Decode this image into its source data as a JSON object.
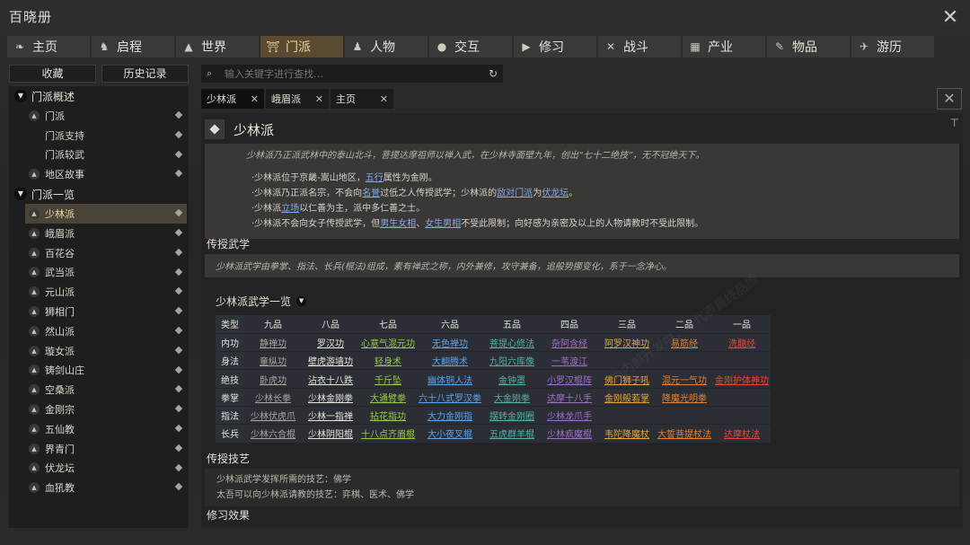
{
  "app": {
    "title": "百晓册",
    "close_icon": "close-x-icon"
  },
  "nav": {
    "tabs": [
      {
        "label": "主页",
        "icon": "book-icon"
      },
      {
        "label": "启程",
        "icon": "horse-icon"
      },
      {
        "label": "世界",
        "icon": "mountain-icon"
      },
      {
        "label": "门派",
        "icon": "gate-icon",
        "active": true
      },
      {
        "label": "人物",
        "icon": "person-icon"
      },
      {
        "label": "交互",
        "icon": "chat-icon"
      },
      {
        "label": "修习",
        "icon": "scroll-icon"
      },
      {
        "label": "战斗",
        "icon": "swords-icon"
      },
      {
        "label": "产业",
        "icon": "building-icon"
      },
      {
        "label": "物品",
        "icon": "item-icon"
      },
      {
        "label": "游历",
        "icon": "travel-icon"
      }
    ]
  },
  "left": {
    "favorites": "收藏",
    "history": "历史记录",
    "groups": [
      {
        "label": "门派概述",
        "items": [
          {
            "label": "门派",
            "expandable": true
          },
          {
            "label": "门派支持",
            "expandable": false
          },
          {
            "label": "门派较武",
            "expandable": false
          },
          {
            "label": "地区故事",
            "expandable": true
          }
        ]
      },
      {
        "label": "门派一览",
        "items": [
          {
            "label": "少林派",
            "expandable": true,
            "active": true
          },
          {
            "label": "峨眉派",
            "expandable": true
          },
          {
            "label": "百花谷",
            "expandable": true
          },
          {
            "label": "武当派",
            "expandable": true
          },
          {
            "label": "元山派",
            "expandable": true
          },
          {
            "label": "狮相门",
            "expandable": true
          },
          {
            "label": "然山派",
            "expandable": true
          },
          {
            "label": "璇女派",
            "expandable": true
          },
          {
            "label": "铸剑山庄",
            "expandable": true
          },
          {
            "label": "空桑派",
            "expandable": true
          },
          {
            "label": "金刚宗",
            "expandable": true
          },
          {
            "label": "五仙教",
            "expandable": true
          },
          {
            "label": "界青门",
            "expandable": true
          },
          {
            "label": "伏龙坛",
            "expandable": true
          },
          {
            "label": "血犼教",
            "expandable": true
          }
        ]
      }
    ]
  },
  "search": {
    "placeholder": "输入关键字进行查找…",
    "value": ""
  },
  "page_tabs": [
    {
      "label": "少林派",
      "active": true
    },
    {
      "label": "峨眉派"
    },
    {
      "label": "主页"
    }
  ],
  "page": {
    "title": "少林派",
    "quote": "少林派乃正派武林中的泰山北斗，菩提达摩祖师以禅入武，在少林寺面壁九年，创出“七十二绝技”，无不冠绝天下。",
    "bullets": [
      [
        {
          "t": "·少林派位于京畿-嵩山地区，"
        },
        {
          "t": "五行",
          "link": true
        },
        {
          "t": "属性为金刚。"
        }
      ],
      [
        {
          "t": "·少林派乃正派名宗，不会向"
        },
        {
          "t": "名誉",
          "link": true
        },
        {
          "t": "过低之人传授武学；少林派的"
        },
        {
          "t": "敌对门派",
          "link": true
        },
        {
          "t": "为"
        },
        {
          "t": "伏龙坛",
          "link": true
        },
        {
          "t": "。"
        }
      ],
      [
        {
          "t": "·少林派"
        },
        {
          "t": "立场",
          "link": true
        },
        {
          "t": "以仁善为主，派中多仁善之士。"
        }
      ],
      [
        {
          "t": "·少林派不会向女子传授武学，但"
        },
        {
          "t": "男生女相",
          "link": true
        },
        {
          "t": "、"
        },
        {
          "t": "女生男相",
          "link": true
        },
        {
          "t": "不受此限制；向好感为亲密及以上的人物请教时不受此限制。"
        }
      ]
    ],
    "sec_wuxue": "传授武学",
    "wuxue_desc": "少林派武学由拳掌、指法、长兵(棍法)组成，素有禅武之称，内外兼修，攻守兼备，追般势挪变化，系于一念净心。",
    "martial_title": "少林派武学一览",
    "table": {
      "header": [
        "类型",
        "九品",
        "八品",
        "七品",
        "六品",
        "五品",
        "四品",
        "三品",
        "二品",
        "一品"
      ],
      "rows": [
        {
          "type": "内功",
          "cells": [
            {
              "t": "静禅功",
              "c": "#a9a59d"
            },
            {
              "t": "罗汉功",
              "c": "#e8e3d9"
            },
            {
              "t": "心意气混元功",
              "c": "#9ac94a"
            },
            {
              "t": "无色禅功",
              "c": "#5ea2e8"
            },
            {
              "t": "菩提心修法",
              "c": "#56b0a8"
            },
            {
              "t": "杂阿含经",
              "c": "#a070c8"
            },
            {
              "t": "阿罗汉神功",
              "c": "#e3a53a"
            },
            {
              "t": "易筋经",
              "c": "#e08030"
            },
            {
              "t": "洗髓经",
              "c": "#e04a3a"
            }
          ]
        },
        {
          "type": "身法",
          "cells": [
            {
              "t": "童纵功",
              "c": "#a9a59d"
            },
            {
              "t": "壁虎游墙功",
              "c": "#e8e3d9"
            },
            {
              "t": "轻身术",
              "c": "#9ac94a"
            },
            {
              "t": "大翻腾术",
              "c": "#5ea2e8"
            },
            {
              "t": "九阳六库像",
              "c": "#56b0a8"
            },
            {
              "t": "一苇渡江",
              "c": "#a070c8"
            },
            {
              "t": "",
              "c": "#888"
            },
            {
              "t": "",
              "c": "#888"
            },
            {
              "t": "",
              "c": "#888"
            }
          ]
        },
        {
          "type": "绝技",
          "cells": [
            {
              "t": "卧虎功",
              "c": "#a9a59d"
            },
            {
              "t": "沾衣十八跌",
              "c": "#e8e3d9"
            },
            {
              "t": "千斤坠",
              "c": "#9ac94a"
            },
            {
              "t": "幽体铜人法",
              "c": "#5ea2e8"
            },
            {
              "t": "金钟罩",
              "c": "#56b0a8"
            },
            {
              "t": "小罗汉棍阵",
              "c": "#a070c8"
            },
            {
              "t": "佛门狮子吼",
              "c": "#e3a53a"
            },
            {
              "t": "混元一气功",
              "c": "#e08030"
            },
            {
              "t": "金刚护体神功",
              "c": "#e04a3a"
            }
          ]
        },
        {
          "type": "拳掌",
          "cells": [
            {
              "t": "少林长拳",
              "c": "#a9a59d"
            },
            {
              "t": "少林金刚拳",
              "c": "#e8e3d9"
            },
            {
              "t": "大通臂拳",
              "c": "#9ac94a"
            },
            {
              "t": "六十八式罗汉拳",
              "c": "#5ea2e8"
            },
            {
              "t": "大金刚拳",
              "c": "#56b0a8"
            },
            {
              "t": "达摩十八手",
              "c": "#a070c8"
            },
            {
              "t": "金刚般若掌",
              "c": "#e3a53a"
            },
            {
              "t": "降魔光明拳",
              "c": "#e08030"
            },
            {
              "t": "",
              "c": "#888"
            }
          ]
        },
        {
          "type": "指法",
          "cells": [
            {
              "t": "少林伏虎爪",
              "c": "#a9a59d"
            },
            {
              "t": "少林一指禅",
              "c": "#e8e3d9"
            },
            {
              "t": "拈花指功",
              "c": "#9ac94a"
            },
            {
              "t": "大力金刚指",
              "c": "#5ea2e8"
            },
            {
              "t": "摆转金刚圈",
              "c": "#56b0a8"
            },
            {
              "t": "少林龙爪手",
              "c": "#a070c8"
            },
            {
              "t": "",
              "c": "#888"
            },
            {
              "t": "",
              "c": "#888"
            },
            {
              "t": "",
              "c": "#888"
            }
          ]
        },
        {
          "type": "长兵",
          "cells": [
            {
              "t": "少林六合棍",
              "c": "#a9a59d"
            },
            {
              "t": "少林阴阳棍",
              "c": "#e8e3d9"
            },
            {
              "t": "十八点齐眉棍",
              "c": "#9ac94a"
            },
            {
              "t": "大小夜叉棍",
              "c": "#5ea2e8"
            },
            {
              "t": "五虎群羊棍",
              "c": "#56b0a8"
            },
            {
              "t": "少林疯魔棍",
              "c": "#a070c8"
            },
            {
              "t": "韦陀降魔杖",
              "c": "#e3a53a"
            },
            {
              "t": "大誓菩提杖法",
              "c": "#e08030"
            },
            {
              "t": "达摩杖法",
              "c": "#e04a3a"
            }
          ]
        }
      ]
    },
    "sec_jiyi": "传授技艺",
    "jiyi_lines": [
      "少林派武学发挥所需的技艺：佛学",
      "太吾可以向少林派请教的技艺：弈棋、医术、佛学"
    ],
    "sec_xiuxi": "修习效果"
  },
  "watermark": "为内部开发中，不代表最终品质"
}
